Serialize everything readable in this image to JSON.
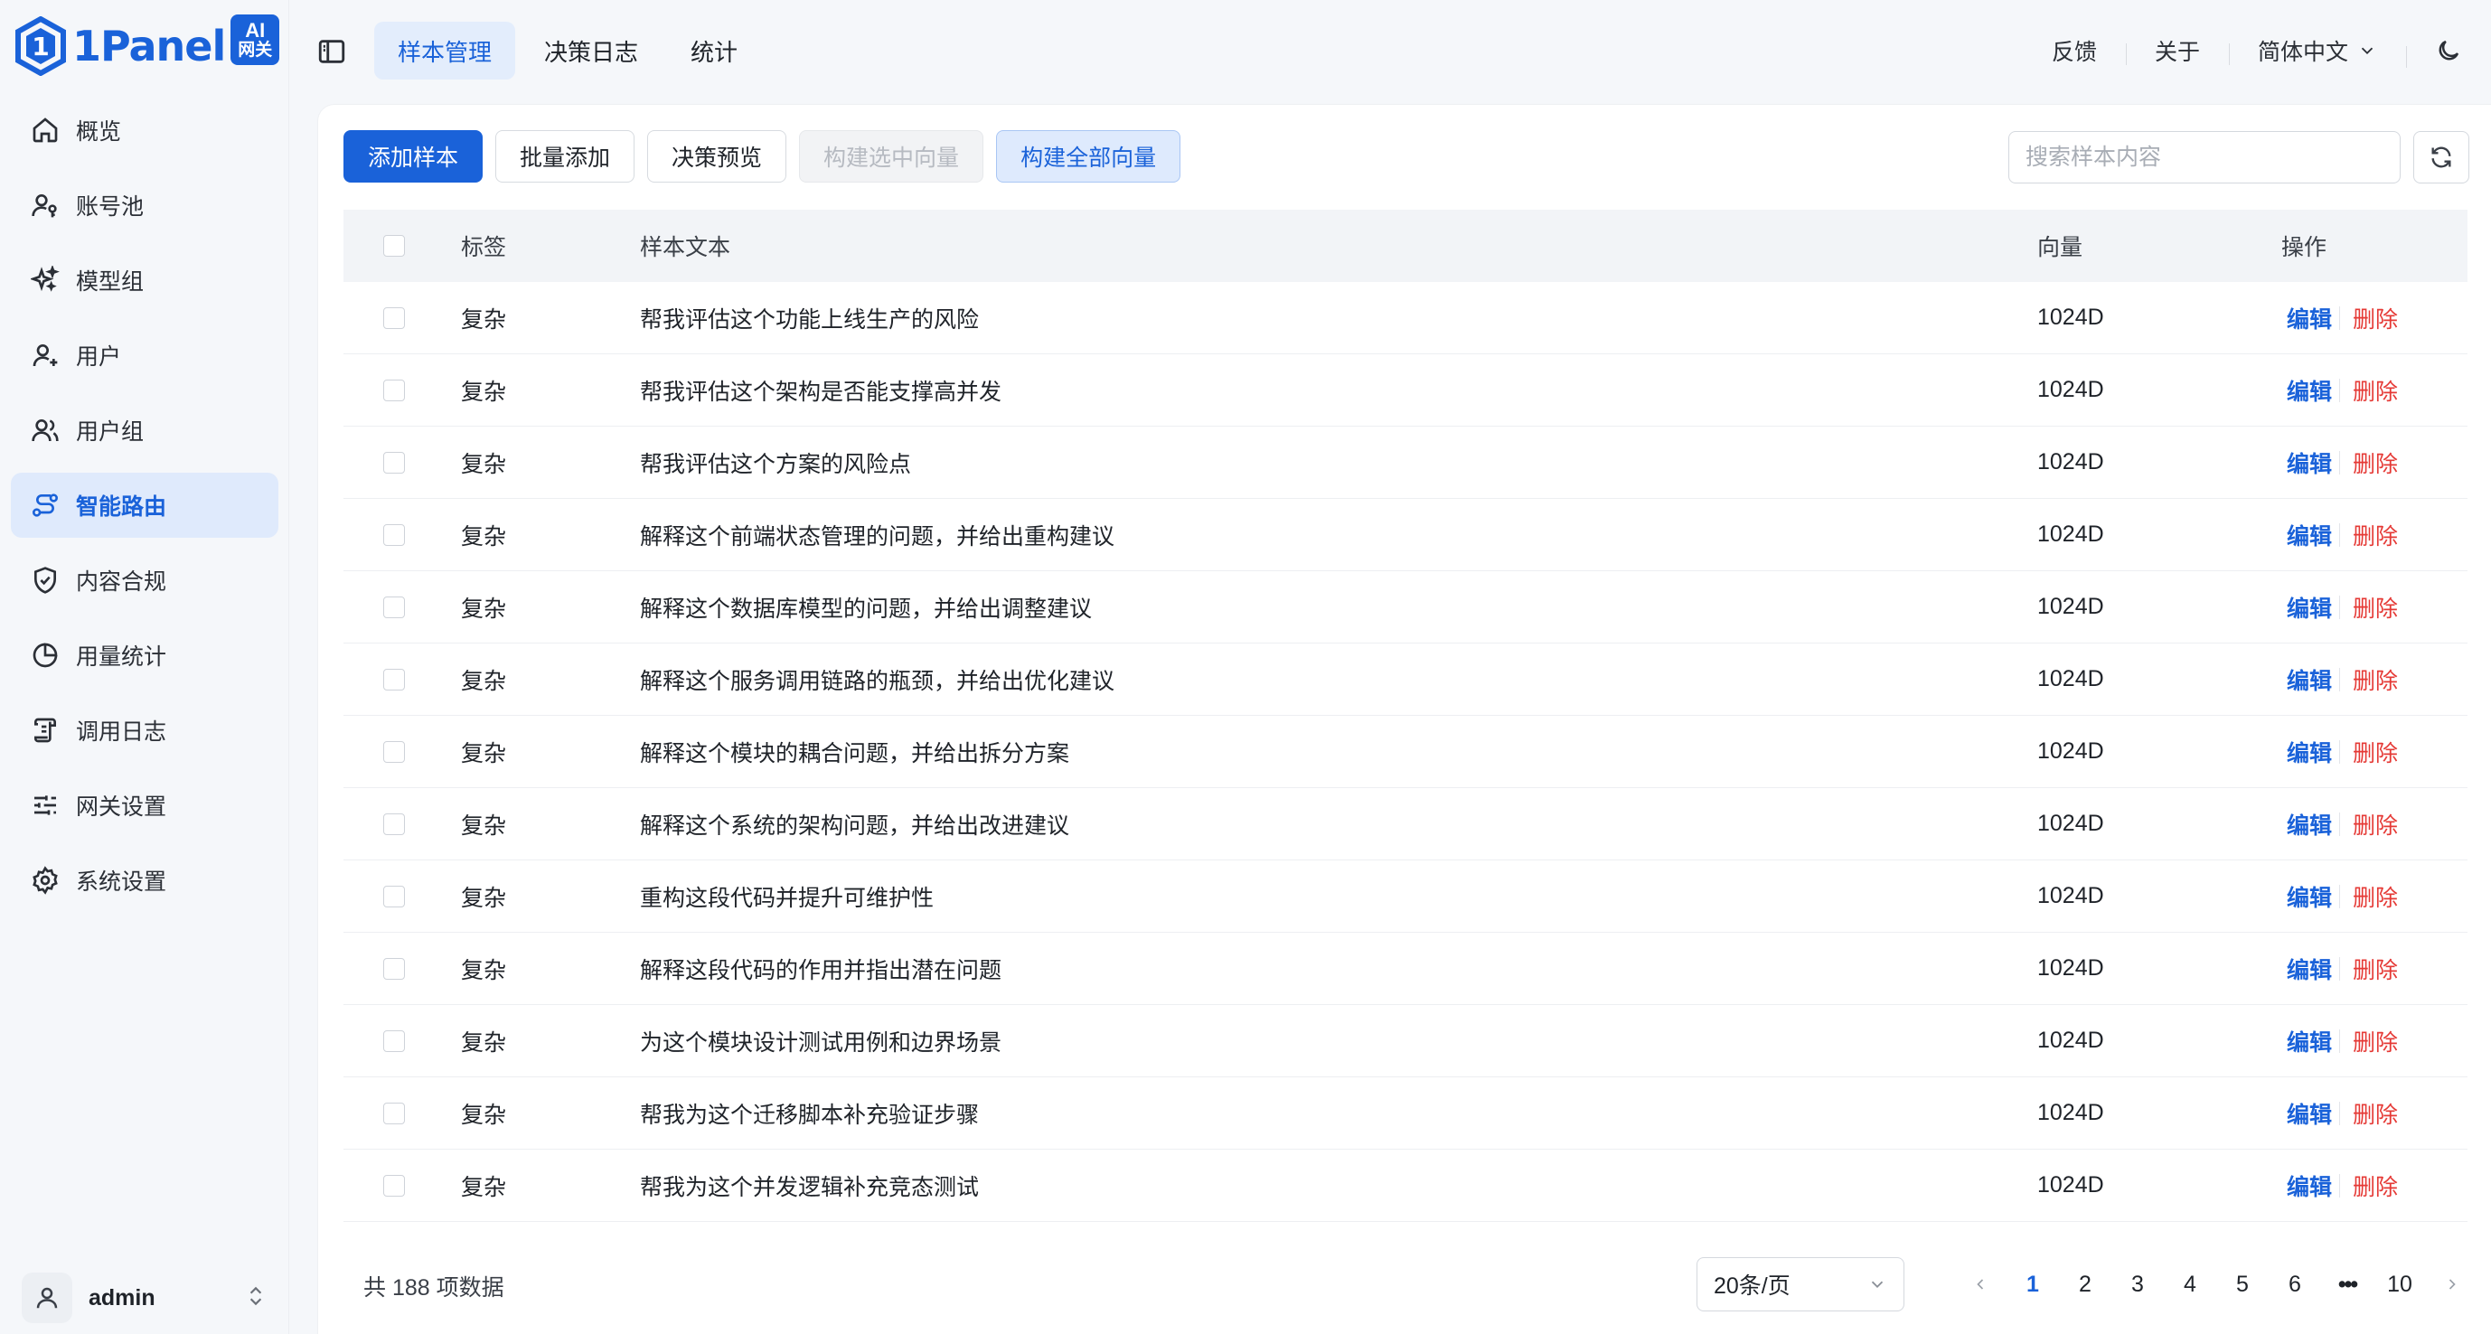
{
  "brand": {
    "name": "1Panel",
    "badge_line1": "AI",
    "badge_line2": "网关",
    "color": "#1a62d9"
  },
  "sidebar": {
    "items": [
      {
        "label": "概览",
        "icon": "home-icon",
        "active": false
      },
      {
        "label": "账号池",
        "icon": "user-key-icon",
        "active": false
      },
      {
        "label": "模型组",
        "icon": "sparkles-icon",
        "active": false
      },
      {
        "label": "用户",
        "icon": "user-plus-icon",
        "active": false
      },
      {
        "label": "用户组",
        "icon": "users-icon",
        "active": false
      },
      {
        "label": "智能路由",
        "icon": "route-icon",
        "active": true
      },
      {
        "label": "内容合规",
        "icon": "shield-check-icon",
        "active": false
      },
      {
        "label": "用量统计",
        "icon": "pie-chart-icon",
        "active": false
      },
      {
        "label": "调用日志",
        "icon": "scroll-icon",
        "active": false
      },
      {
        "label": "网关设置",
        "icon": "sliders-icon",
        "active": false
      },
      {
        "label": "系统设置",
        "icon": "gear-icon",
        "active": false
      }
    ]
  },
  "user": {
    "name": "admin"
  },
  "header": {
    "tabs": [
      {
        "label": "样本管理",
        "active": true
      },
      {
        "label": "决策日志",
        "active": false
      },
      {
        "label": "统计",
        "active": false
      }
    ],
    "feedback": "反馈",
    "about": "关于",
    "language": "简体中文"
  },
  "toolbar": {
    "add": "添加样本",
    "batch_add": "批量添加",
    "preview": "决策预览",
    "build_selected": "构建选中向量",
    "build_all": "构建全部向量",
    "search_placeholder": "搜索样本内容"
  },
  "table": {
    "headers": {
      "label": "标签",
      "text": "样本文本",
      "vector": "向量",
      "ops": "操作"
    },
    "edit": "编辑",
    "delete": "删除",
    "rows": [
      {
        "label": "复杂",
        "text": "帮我评估这个功能上线生产的风险",
        "vector": "1024D"
      },
      {
        "label": "复杂",
        "text": "帮我评估这个架构是否能支撑高并发",
        "vector": "1024D"
      },
      {
        "label": "复杂",
        "text": "帮我评估这个方案的风险点",
        "vector": "1024D"
      },
      {
        "label": "复杂",
        "text": "解释这个前端状态管理的问题，并给出重构建议",
        "vector": "1024D"
      },
      {
        "label": "复杂",
        "text": "解释这个数据库模型的问题，并给出调整建议",
        "vector": "1024D"
      },
      {
        "label": "复杂",
        "text": "解释这个服务调用链路的瓶颈，并给出优化建议",
        "vector": "1024D"
      },
      {
        "label": "复杂",
        "text": "解释这个模块的耦合问题，并给出拆分方案",
        "vector": "1024D"
      },
      {
        "label": "复杂",
        "text": "解释这个系统的架构问题，并给出改进建议",
        "vector": "1024D"
      },
      {
        "label": "复杂",
        "text": "重构这段代码并提升可维护性",
        "vector": "1024D"
      },
      {
        "label": "复杂",
        "text": "解释这段代码的作用并指出潜在问题",
        "vector": "1024D"
      },
      {
        "label": "复杂",
        "text": "为这个模块设计测试用例和边界场景",
        "vector": "1024D"
      },
      {
        "label": "复杂",
        "text": "帮我为这个迁移脚本补充验证步骤",
        "vector": "1024D"
      },
      {
        "label": "复杂",
        "text": "帮我为这个并发逻辑补充竞态测试",
        "vector": "1024D"
      }
    ]
  },
  "footer": {
    "total": "共 188 项数据",
    "page_size": "20条/页",
    "pages": [
      "1",
      "2",
      "3",
      "4",
      "5",
      "6"
    ],
    "ellipsis": "•••",
    "last_page": "10",
    "current_page": "1"
  }
}
